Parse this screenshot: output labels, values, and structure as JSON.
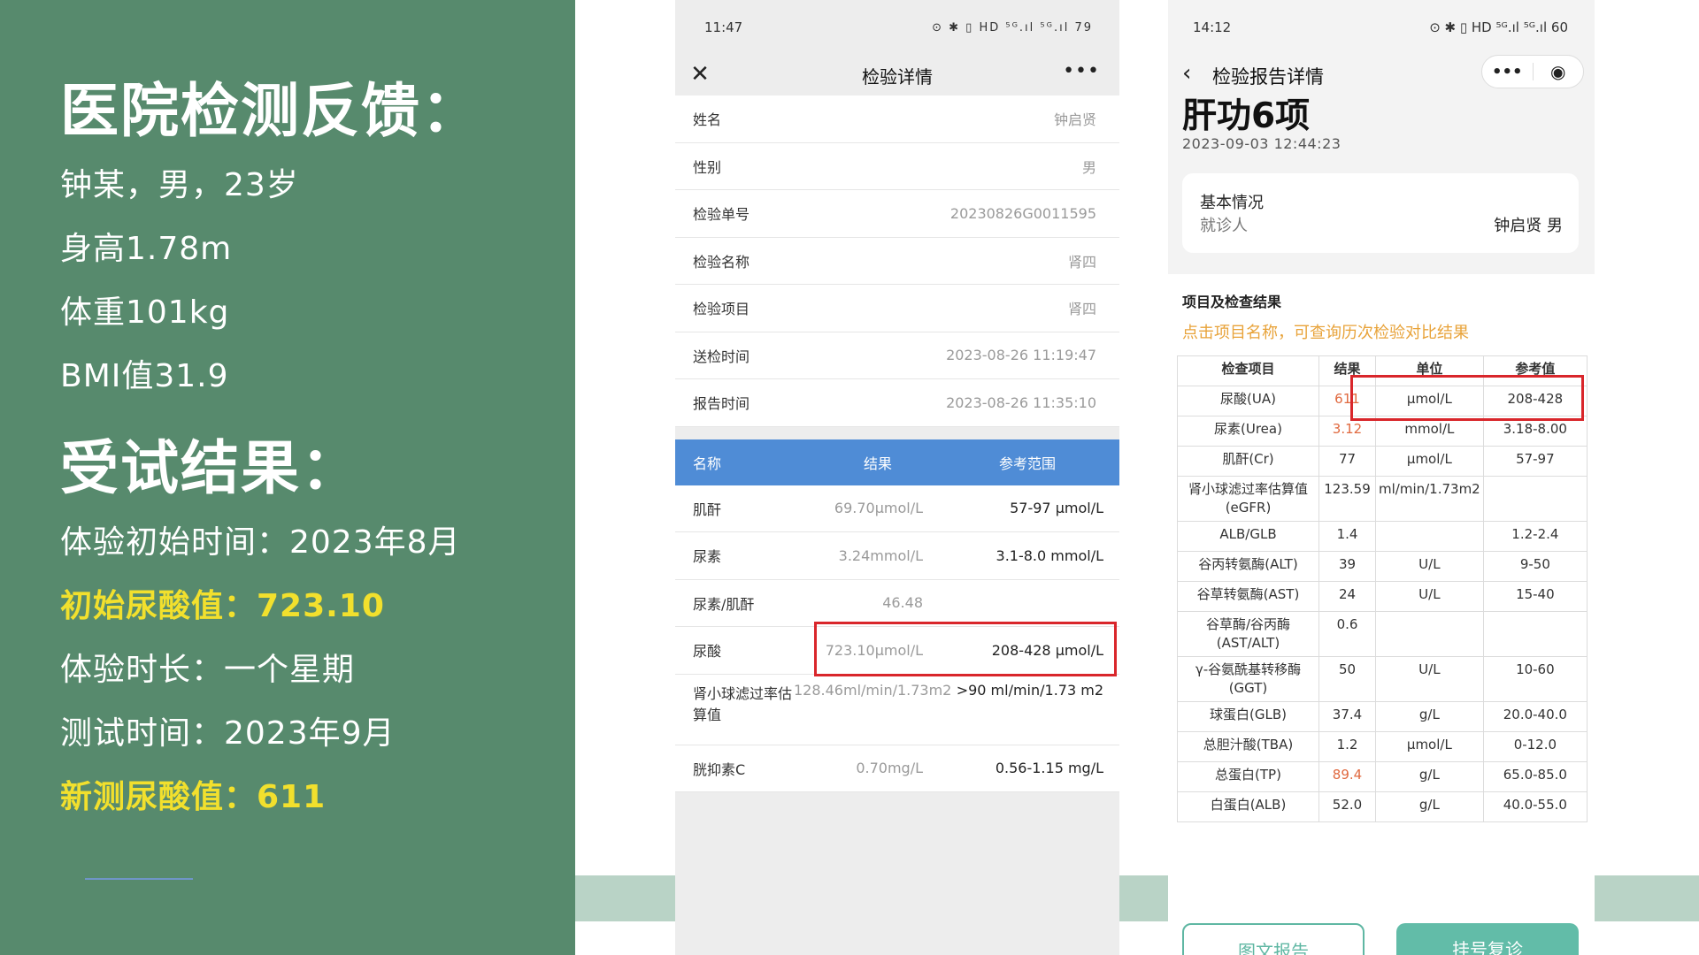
{
  "left": {
    "heading1": "医院检测反馈：",
    "patient": "钟某，男，23岁",
    "height": "身高1.78m",
    "weight": "体重101kg",
    "bmi": "BMI值31.9",
    "heading2": "受试结果：",
    "start_time": "体验初始时间：2023年8月",
    "initial_ua": "初始尿酸值：723.10",
    "duration": "体验时长：一个星期",
    "test_time": "测试时间：2023年9月",
    "new_ua": "新测尿酸值：611",
    "highlight_color": "#f2e02d",
    "panel_color": "#578a6d"
  },
  "phone1": {
    "status_time": "11:47",
    "status_icons": "⊙ ✱ ▯ HD ⁵ᴳ.ıl ⁵ᴳ.ıl 79",
    "title": "检验详情",
    "info_rows": [
      {
        "k": "姓名",
        "v": "钟启贤"
      },
      {
        "k": "性别",
        "v": "男"
      },
      {
        "k": "检验单号",
        "v": "20230826G0011595"
      },
      {
        "k": "检验名称",
        "v": "肾四"
      },
      {
        "k": "检验项目",
        "v": "肾四"
      },
      {
        "k": "送检时间",
        "v": "2023-08-26 11:19:47"
      },
      {
        "k": "报告时间",
        "v": "2023-08-26 11:35:10"
      }
    ],
    "table_head": {
      "name": "名称",
      "result": "结果",
      "range": "参考范围"
    },
    "results": [
      {
        "name": "肌酐",
        "result": "69.70μmol/L",
        "range": "57-97 μmol/L"
      },
      {
        "name": "尿素",
        "result": "3.24mmol/L",
        "range": "3.1-8.0 mmol/L"
      },
      {
        "name": "尿素/肌酐",
        "result": "46.48",
        "range": ""
      },
      {
        "name": "尿酸",
        "result": "723.10μmol/L",
        "range": "208-428 μmol/L"
      },
      {
        "name": "肾小球滤过率估算值",
        "result": "128.46ml/min/1.73m2",
        "range": ">90 ml/min/1.73 m2"
      },
      {
        "name": "胱抑素C",
        "result": "0.70mg/L",
        "range": "0.56-1.15 mg/L"
      }
    ],
    "header_color": "#4f8cd6"
  },
  "phone2": {
    "status_time": "14:12",
    "status_icons": "⊙ ✱ ▯ HD ⁵ᴳ.ıl ⁵ᴳ.ıl 60",
    "title": "检验报告详情",
    "report_title": "肝功6项",
    "report_time": "2023-09-03 12:44:23",
    "card_title": "基本情况",
    "card_key": "就诊人",
    "card_value": "钟启贤 男",
    "section_title": "项目及检查结果",
    "hint": "点击项目名称，可查询历次检验对比结果",
    "columns": [
      "检查项目",
      "结果",
      "单位",
      "参考值"
    ],
    "rows": [
      {
        "item": "尿酸(UA)",
        "result": "611",
        "unit": "μmol/L",
        "ref": "208-428",
        "abnormal": true
      },
      {
        "item": "尿素(Urea)",
        "result": "3.12",
        "unit": "mmol/L",
        "ref": "3.18-8.00",
        "abnormal": true
      },
      {
        "item": "肌酐(Cr)",
        "result": "77",
        "unit": "μmol/L",
        "ref": "57-97",
        "abnormal": false
      },
      {
        "item": "肾小球滤过率估算值(eGFR)",
        "result": "123.59",
        "unit": "ml/min/1.73m2",
        "ref": "",
        "abnormal": false
      },
      {
        "item": "ALB/GLB",
        "result": "1.4",
        "unit": "",
        "ref": "1.2-2.4",
        "abnormal": false
      },
      {
        "item": "谷丙转氨酶(ALT)",
        "result": "39",
        "unit": "U/L",
        "ref": "9-50",
        "abnormal": false
      },
      {
        "item": "谷草转氨酶(AST)",
        "result": "24",
        "unit": "U/L",
        "ref": "15-40",
        "abnormal": false
      },
      {
        "item": "谷草酶/谷丙酶(AST/ALT)",
        "result": "0.6",
        "unit": "",
        "ref": "",
        "abnormal": false
      },
      {
        "item": "γ-谷氨酰基转移酶(GGT)",
        "result": "50",
        "unit": "U/L",
        "ref": "10-60",
        "abnormal": false
      },
      {
        "item": "球蛋白(GLB)",
        "result": "37.4",
        "unit": "g/L",
        "ref": "20.0-40.0",
        "abnormal": false
      },
      {
        "item": "总胆汁酸(TBA)",
        "result": "1.2",
        "unit": "μmol/L",
        "ref": "0-12.0",
        "abnormal": false
      },
      {
        "item": "总蛋白(TP)",
        "result": "89.4",
        "unit": "g/L",
        "ref": "65.0-85.0",
        "abnormal": true
      },
      {
        "item": "白蛋白(ALB)",
        "result": "52.0",
        "unit": "g/L",
        "ref": "40.0-55.0",
        "abnormal": false
      }
    ],
    "btn_left": "图文报告",
    "btn_right": "挂号复诊",
    "abnormal_color": "#e0693f",
    "accent_color": "#62bca8"
  }
}
